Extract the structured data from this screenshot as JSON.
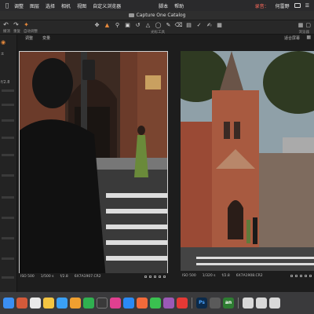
{
  "menubar": {
    "items": [
      "调整",
      "图层",
      "选择",
      "相机",
      "视图",
      "自定义浏览器",
      "脚本",
      "帮助"
    ],
    "recording": "录音：",
    "user": "何雷野"
  },
  "window": {
    "title": "Capture One Catalog"
  },
  "toolbar": {
    "left_labels": [
      "撤消",
      "重复",
      "自动调整"
    ],
    "tools_label": "光标工具",
    "fit_label": "适合屏幕",
    "right_label": "浏览器"
  },
  "viewer": {
    "left_top": "调整",
    "left_top2": "变量",
    "zoom": "适合屏幕"
  },
  "left_panel": {
    "rows": [
      "±",
      "",
      "f/2.8",
      "ISO",
      "",
      "",
      "",
      "",
      "",
      "",
      "",
      "",
      "",
      ""
    ]
  },
  "captions": {
    "left": {
      "iso": "ISO 500",
      "shutter": "1/500 s",
      "aperture": "f/2.8",
      "file": "6X7A1907.CR2"
    },
    "right": {
      "iso": "ISO 500",
      "shutter": "1/320 s",
      "aperture": "f/2.8",
      "file": "6X7A1908.CR2"
    }
  },
  "dock": {
    "apps": [
      "finder-app",
      "launchpad-app",
      "safari-app",
      "chrome-app",
      "mail-app",
      "notes-app",
      "calendar-app",
      "photos-app",
      "appstore-app",
      "settings-app",
      "music-app",
      "wechat-app",
      "qq-app",
      "netease-app",
      "photoshop-app",
      "capture-one-app",
      "xiaohongshu-app",
      "keyboard-app"
    ],
    "ps_label": "Ps",
    "an_label": "an"
  },
  "colors": {
    "accent": "#e88a3c",
    "menubar_bg": "#2a2a2c",
    "toolbar_bg": "#282828",
    "panel_bg": "#232323"
  }
}
